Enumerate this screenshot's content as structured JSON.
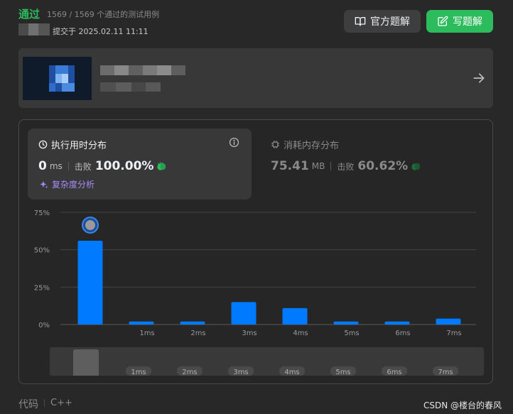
{
  "header": {
    "status": "通过",
    "counts": "1569 / 1569 个通过的测试用例",
    "submitted": "提交于 2025.02.11 11:11",
    "editorial_label": "官方题解",
    "write_solution_label": "写题解"
  },
  "runtime": {
    "title": "执行用时分布",
    "value": "0",
    "unit": "ms",
    "beats_label": "击败",
    "beats_value": "100.00%",
    "complexity_label": "复杂度分析"
  },
  "memory": {
    "title": "消耗内存分布",
    "value": "75.41",
    "unit": "MB",
    "beats_label": "击败",
    "beats_value": "60.62%"
  },
  "colors": {
    "accepted": "#2cbb5d",
    "bar": "#007aff",
    "purple": "#a78bfa"
  },
  "icons": {
    "editorial": "book-open-icon",
    "write": "edit-icon",
    "arrow": "arrow-right-icon",
    "runtime": "clock-icon",
    "memory": "chip-icon",
    "info": "info-icon",
    "complexity": "sparkle-icon",
    "beats": "clapping-hands-icon"
  },
  "chart_data": {
    "type": "bar",
    "categories": [
      "",
      "1ms",
      "2ms",
      "3ms",
      "4ms",
      "5ms",
      "6ms",
      "7ms"
    ],
    "values": [
      56,
      2,
      2,
      15,
      11,
      2,
      2,
      4
    ],
    "ylim": [
      0,
      75
    ],
    "yticks": [
      "75%",
      "50%",
      "25%",
      "0%"
    ],
    "ytick_values": [
      75,
      50,
      25,
      0
    ],
    "highlight_index": 0,
    "grid": true,
    "overview_labels": [
      "1ms",
      "2ms",
      "3ms",
      "4ms",
      "5ms",
      "6ms",
      "7ms"
    ]
  },
  "footer": {
    "code_label": "代码",
    "language": "C++",
    "watermark": "CSDN @楼台的春风"
  }
}
